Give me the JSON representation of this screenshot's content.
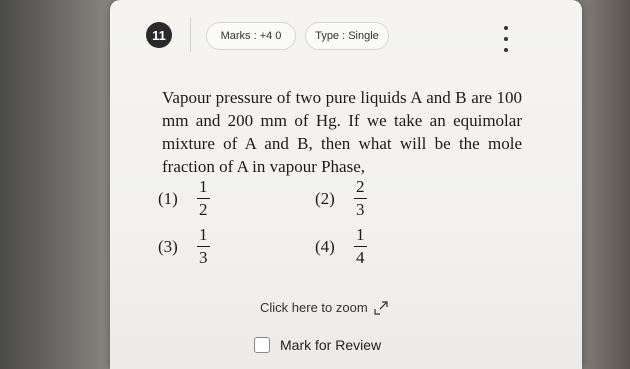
{
  "question": {
    "number": "11",
    "marks_label": "Marks : +4 0",
    "type_label": "Type : Single",
    "text": "Vapour pressure of two pure liquids A and B are 100 mm and 200 mm of Hg. If we take an equimolar mixture of A and B, then what will be the mole fraction of A in vapour Phase,"
  },
  "options": [
    {
      "label": "(1)",
      "num": "1",
      "den": "2"
    },
    {
      "label": "(2)",
      "num": "2",
      "den": "3"
    },
    {
      "label": "(3)",
      "num": "1",
      "den": "3"
    },
    {
      "label": "(4)",
      "num": "1",
      "den": "4"
    }
  ],
  "footer": {
    "zoom_label": "Click here to zoom",
    "review_label": "Mark for Review"
  },
  "icons": {
    "menu": "kebab-vertical-icon",
    "zoom": "expand-arrow-icon",
    "review": "checkbox-icon"
  }
}
